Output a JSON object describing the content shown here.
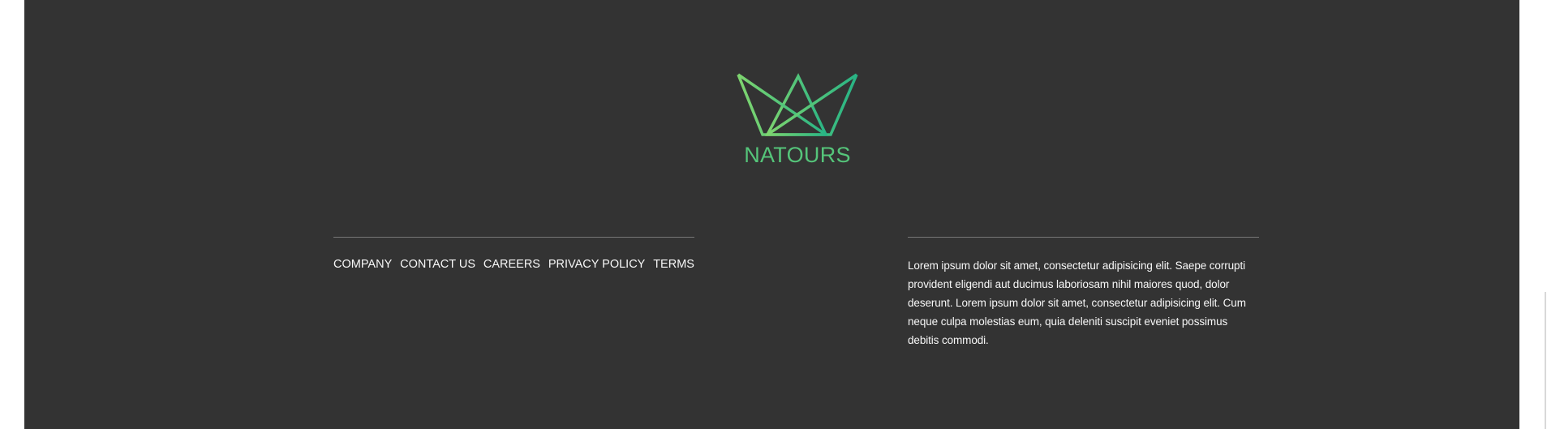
{
  "footer": {
    "brand": "NATOURS",
    "logo_icon": "crown-logo-icon",
    "colors": {
      "background": "#333333",
      "brand_green": "#55c57a",
      "brand_green_dark": "#28b485",
      "text": "#f7f7f7",
      "divider": "#777777"
    },
    "nav": [
      {
        "label": "COMPANY"
      },
      {
        "label": "CONTACT US"
      },
      {
        "label": "CAREERS"
      },
      {
        "label": "PRIVACY POLICY"
      },
      {
        "label": "TERMS"
      }
    ],
    "about_text": "Lorem ipsum dolor sit amet, consectetur adipisicing elit. Saepe corrupti provident eligendi aut ducimus laboriosam nihil maiores quod, dolor deserunt. Lorem ipsum dolor sit amet, consectetur adipisicing elit. Cum neque culpa molestias eum, quia deleniti suscipit eveniet possimus debitis commodi."
  }
}
